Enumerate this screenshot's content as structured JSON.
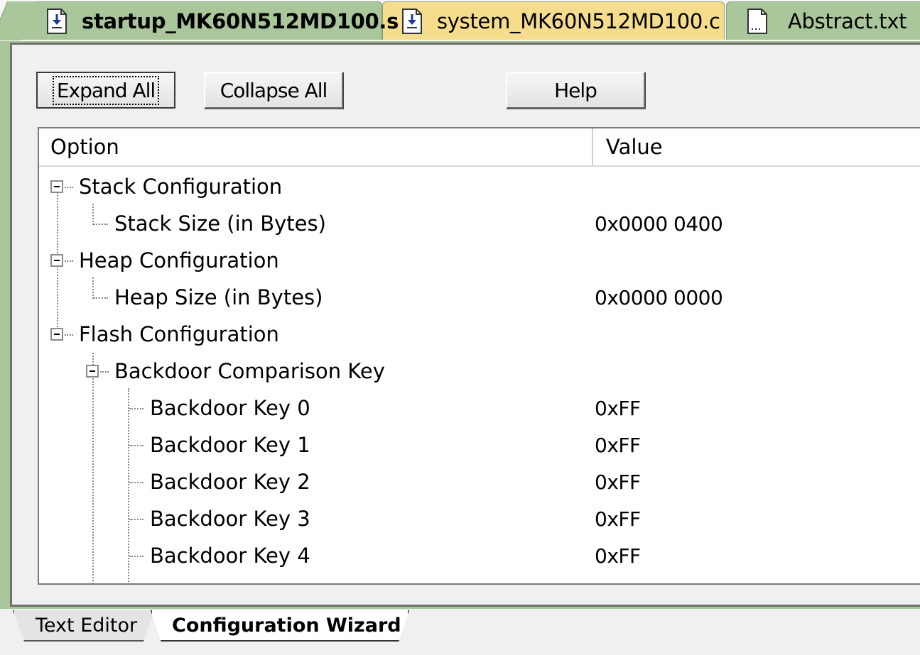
{
  "file_tabs": [
    {
      "label": "startup_MK60N512MD100.s",
      "icon": "file-download-icon",
      "active": true
    },
    {
      "label": "system_MK60N512MD100.c",
      "icon": "file-download-icon",
      "active": false
    },
    {
      "label": "Abstract.txt",
      "icon": "text-file-icon",
      "active": false
    }
  ],
  "toolbar": {
    "expand_label": "Expand All",
    "collapse_label": "Collapse All",
    "help_label": "Help"
  },
  "grid": {
    "columns": [
      "Option",
      "Value"
    ],
    "rows": [
      {
        "label": "Stack Configuration",
        "value": "",
        "expandable": true
      },
      {
        "label": "Stack Size (in Bytes)",
        "value": "0x0000 0400",
        "expandable": false
      },
      {
        "label": "Heap Configuration",
        "value": "",
        "expandable": true
      },
      {
        "label": "Heap Size (in Bytes)",
        "value": "0x0000 0000",
        "expandable": false
      },
      {
        "label": "Flash Configuration",
        "value": "",
        "expandable": true
      },
      {
        "label": "Backdoor Comparison Key",
        "value": "",
        "expandable": true
      },
      {
        "label": "Backdoor Key 0",
        "value": "0xFF",
        "expandable": false
      },
      {
        "label": "Backdoor Key 1",
        "value": "0xFF",
        "expandable": false
      },
      {
        "label": "Backdoor Key 2",
        "value": "0xFF",
        "expandable": false
      },
      {
        "label": "Backdoor Key 3",
        "value": "0xFF",
        "expandable": false
      },
      {
        "label": "Backdoor Key 4",
        "value": "0xFF",
        "expandable": false
      }
    ]
  },
  "view_tabs": [
    {
      "label": "Text Editor",
      "active": false
    },
    {
      "label": "Configuration Wizard",
      "active": true
    }
  ],
  "colors": {
    "tab_green": "#a9c79a",
    "tab_yellow": "#f6dd8e",
    "panel_bg": "#f0f0f0"
  }
}
